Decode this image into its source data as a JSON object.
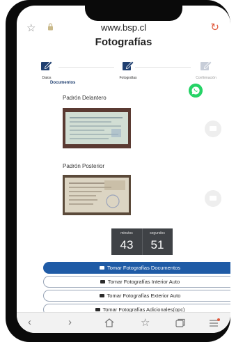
{
  "browser": {
    "url": "www.bsp.cl"
  },
  "page": {
    "title": "Fotografías",
    "steps": [
      {
        "label": "Datos"
      },
      {
        "label": "Fotografias"
      },
      {
        "label": "Confirmación"
      }
    ],
    "documents_label": "Documentos",
    "sections": [
      {
        "label": "Padrón Delantero"
      },
      {
        "label": "Padrón Posterior"
      }
    ],
    "timer": {
      "minutes_label": "minutos",
      "seconds_label": "segundos",
      "minutes": "43",
      "seconds": "51"
    },
    "buttons": [
      {
        "label": "Tomar Fotografías Documentos"
      },
      {
        "label": "Tomar Fotografías Interior Auto"
      },
      {
        "label": "Tomar Fotografías Exterior Auto"
      },
      {
        "label": "Tomar Fotografías Adicionales(opc)"
      }
    ]
  },
  "colors": {
    "primary": "#1f5ba6",
    "whatsapp": "#25d366",
    "reload": "#e0573a",
    "heading": "#1f3f70"
  },
  "icons": [
    "star-icon",
    "lock-icon",
    "reload-icon",
    "edit-icon",
    "whatsapp-icon",
    "camera-icon",
    "back-icon",
    "forward-icon",
    "home-icon",
    "bookmark-icon",
    "tabs-icon",
    "menu-icon"
  ]
}
